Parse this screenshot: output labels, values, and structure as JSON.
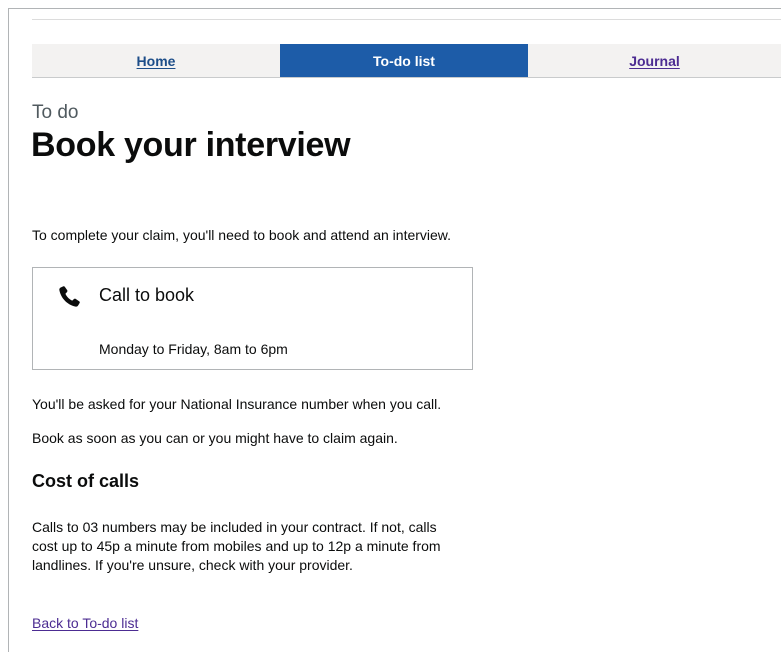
{
  "nav": {
    "items": [
      {
        "label": "Home"
      },
      {
        "label": "To-do list"
      },
      {
        "label": "Journal"
      }
    ]
  },
  "page": {
    "caption": "To do",
    "title": "Book your interview"
  },
  "intro": "To complete your claim, you'll need to book and attend an interview.",
  "call_card": {
    "icon": "phone-icon",
    "title": "Call to book",
    "hours": "Monday to Friday, 8am to 6pm"
  },
  "notes": [
    "You'll be asked for your National Insurance number when you call.",
    "Book as soon as you can or you might have to claim again."
  ],
  "cost": {
    "heading": "Cost of calls",
    "lines": [
      "Calls to 03 numbers may be included in your contract. If not, calls",
      "cost up to 45p a minute from mobiles and up to 12p a minute from",
      "landlines. If you're unsure, check with your provider."
    ]
  },
  "back_link": "Back to To-do list",
  "colors": {
    "nav_active": "#1d5ca8",
    "link": "#1d4e89",
    "visited_link": "#4c2c92",
    "text": "#0b0c0c"
  }
}
